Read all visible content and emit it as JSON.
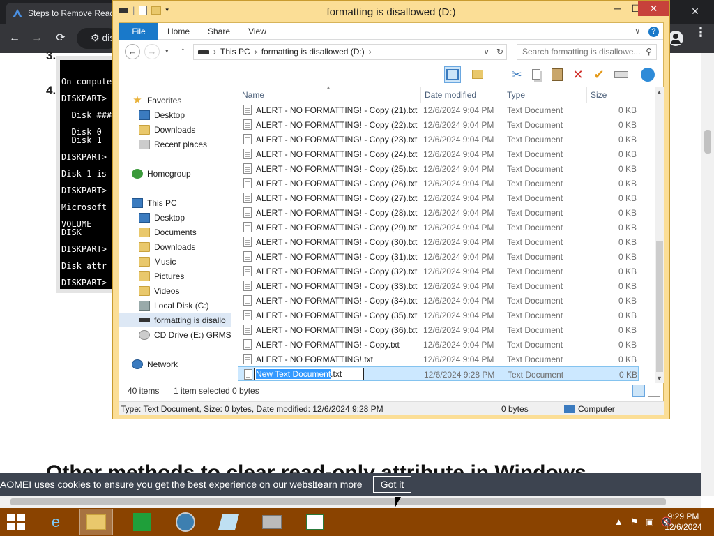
{
  "browser": {
    "tab_title": "Steps to Remove Read",
    "omnibox_text": "dis",
    "back": "←",
    "forward": "→",
    "reload": "⟳",
    "site_info": "⚙",
    "minimize": "─",
    "maximize": "☐",
    "close": "✕",
    "kebab": "⋮"
  },
  "page": {
    "step3": "3.",
    "step4": "4.",
    "cmd_lines": [
      "On compute",
      "DISKPART>",
      "  Disk ###",
      "  --------",
      "  Disk 0",
      "  Disk 1",
      "DISKPART>",
      "Disk 1 is",
      "DISKPART>",
      "Microsoft",
      "VOLUME",
      "DISK",
      "DISKPART>",
      "Disk attr",
      "DISKPART>"
    ],
    "heading": "Other methods to clear read-only attribute in Windows",
    "cookie_text": "AOMEI uses cookies to ensure you get the best experience on our website.",
    "cookie_learn": "Learn more",
    "cookie_got": "Got it"
  },
  "explorer": {
    "title": "formatting is disallowed (D:)",
    "win_min": "─",
    "win_max": "☐",
    "win_close": "✕",
    "ribbon_tabs": [
      "File",
      "Home",
      "Share",
      "View"
    ],
    "ribbon_chevron": "∨",
    "help": "?",
    "nav_back": "←",
    "nav_fwd": "→",
    "nav_recent": "▾",
    "nav_up": "↑",
    "address": {
      "root": "This PC",
      "drive": "formatting is disallowed (D:)",
      "sep": "›",
      "dropdown": "∨",
      "refresh": "↻"
    },
    "search_placeholder": "Search formatting is disallowe...",
    "search_icon": "⚲",
    "nav_pane": {
      "favorites": "Favorites",
      "fav_items": [
        "Desktop",
        "Downloads",
        "Recent places"
      ],
      "homegroup": "Homegroup",
      "this_pc": "This PC",
      "pc_items": [
        "Desktop",
        "Documents",
        "Downloads",
        "Music",
        "Pictures",
        "Videos",
        "Local Disk (C:)",
        "formatting is disallo",
        "CD Drive (E:) GRMSX"
      ],
      "network": "Network"
    },
    "columns": {
      "name": "Name",
      "date": "Date modified",
      "type": "Type",
      "size": "Size"
    },
    "files": [
      {
        "name": "ALERT - NO FORMATTING! - Copy (21).txt",
        "date": "12/6/2024 9:04 PM",
        "type": "Text Document",
        "size": "0 KB"
      },
      {
        "name": "ALERT - NO FORMATTING! - Copy (22).txt",
        "date": "12/6/2024 9:04 PM",
        "type": "Text Document",
        "size": "0 KB"
      },
      {
        "name": "ALERT - NO FORMATTING! - Copy (23).txt",
        "date": "12/6/2024 9:04 PM",
        "type": "Text Document",
        "size": "0 KB"
      },
      {
        "name": "ALERT - NO FORMATTING! - Copy (24).txt",
        "date": "12/6/2024 9:04 PM",
        "type": "Text Document",
        "size": "0 KB"
      },
      {
        "name": "ALERT - NO FORMATTING! - Copy (25).txt",
        "date": "12/6/2024 9:04 PM",
        "type": "Text Document",
        "size": "0 KB"
      },
      {
        "name": "ALERT - NO FORMATTING! - Copy (26).txt",
        "date": "12/6/2024 9:04 PM",
        "type": "Text Document",
        "size": "0 KB"
      },
      {
        "name": "ALERT - NO FORMATTING! - Copy (27).txt",
        "date": "12/6/2024 9:04 PM",
        "type": "Text Document",
        "size": "0 KB"
      },
      {
        "name": "ALERT - NO FORMATTING! - Copy (28).txt",
        "date": "12/6/2024 9:04 PM",
        "type": "Text Document",
        "size": "0 KB"
      },
      {
        "name": "ALERT - NO FORMATTING! - Copy (29).txt",
        "date": "12/6/2024 9:04 PM",
        "type": "Text Document",
        "size": "0 KB"
      },
      {
        "name": "ALERT - NO FORMATTING! - Copy (30).txt",
        "date": "12/6/2024 9:04 PM",
        "type": "Text Document",
        "size": "0 KB"
      },
      {
        "name": "ALERT - NO FORMATTING! - Copy (31).txt",
        "date": "12/6/2024 9:04 PM",
        "type": "Text Document",
        "size": "0 KB"
      },
      {
        "name": "ALERT - NO FORMATTING! - Copy (32).txt",
        "date": "12/6/2024 9:04 PM",
        "type": "Text Document",
        "size": "0 KB"
      },
      {
        "name": "ALERT - NO FORMATTING! - Copy (33).txt",
        "date": "12/6/2024 9:04 PM",
        "type": "Text Document",
        "size": "0 KB"
      },
      {
        "name": "ALERT - NO FORMATTING! - Copy (34).txt",
        "date": "12/6/2024 9:04 PM",
        "type": "Text Document",
        "size": "0 KB"
      },
      {
        "name": "ALERT - NO FORMATTING! - Copy (35).txt",
        "date": "12/6/2024 9:04 PM",
        "type": "Text Document",
        "size": "0 KB"
      },
      {
        "name": "ALERT - NO FORMATTING! - Copy (36).txt",
        "date": "12/6/2024 9:04 PM",
        "type": "Text Document",
        "size": "0 KB"
      },
      {
        "name": "ALERT - NO FORMATTING! - Copy.txt",
        "date": "12/6/2024 9:04 PM",
        "type": "Text Document",
        "size": "0 KB"
      },
      {
        "name": "ALERT - NO FORMATTING!.txt",
        "date": "12/6/2024 9:04 PM",
        "type": "Text Document",
        "size": "0 KB"
      }
    ],
    "renaming": {
      "selected": "New Text Document",
      "ext": ".txt",
      "date": "12/6/2024 9:28 PM",
      "type": "Text Document",
      "size": "0 KB"
    },
    "status_count": "40 items",
    "status_selected": "1 item selected  0 bytes",
    "details_left": "Type: Text Document, Size: 0 bytes, Date modified: 12/6/2024 9:28 PM",
    "details_mid": "0 bytes",
    "details_right": "Computer"
  },
  "taskbar": {
    "tray_icons": [
      "▲",
      "⚑",
      "▣",
      "🔇"
    ],
    "time": "9:29 PM",
    "date": "12/6/2024"
  },
  "colors": {
    "taskbar": "#8a4300",
    "window_frame": "#fbde96",
    "file_tab": "#1979ca",
    "selection": "#cce8ff"
  }
}
